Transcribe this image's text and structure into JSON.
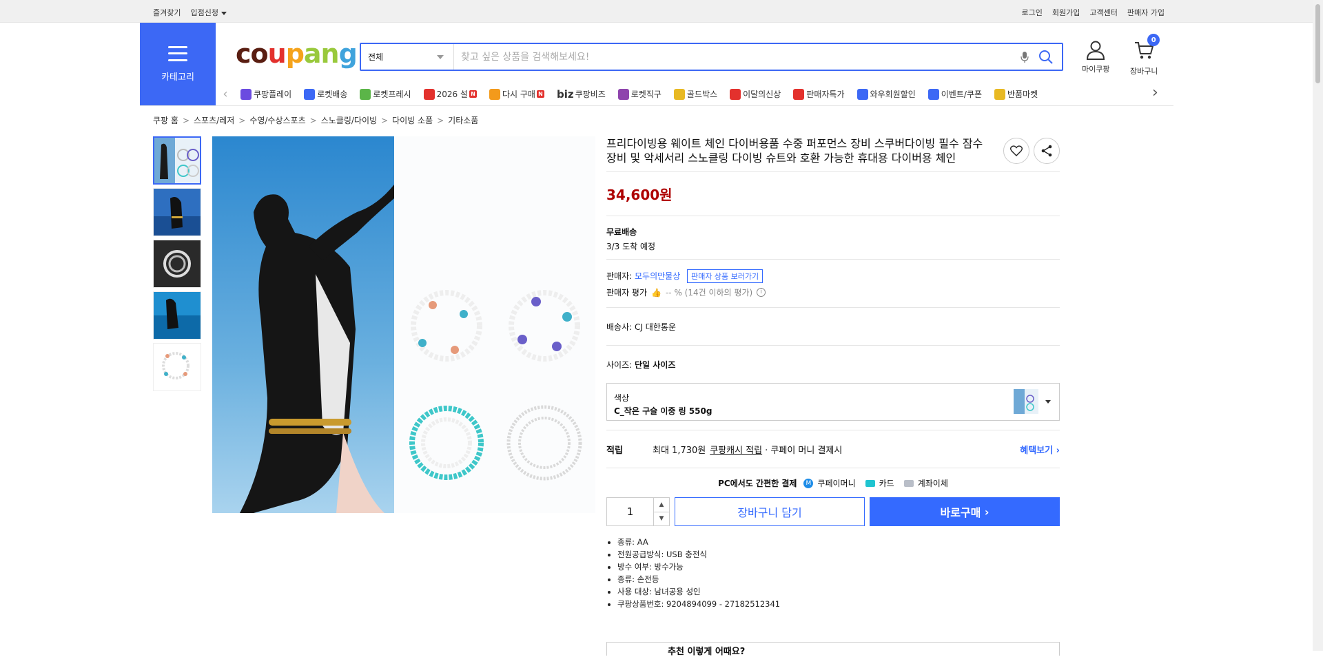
{
  "topbar": {
    "left": [
      "즐겨찾기",
      "입점신청"
    ],
    "right": [
      "로그인",
      "회원가입",
      "고객센터",
      "판매자 가입"
    ]
  },
  "header": {
    "category_label": "카테고리",
    "logo_parts": [
      "co",
      "u",
      "p",
      "an",
      "g"
    ],
    "search_select": "전체",
    "search_placeholder": "찾고 싶은 상품을 검색해보세요!",
    "mypage_label": "마이쿠팡",
    "cart_label": "장바구니",
    "cart_count": "0"
  },
  "nav": [
    {
      "label": "쿠팡플레이",
      "icon": "coupang-play-icon",
      "color": "#6b4be0",
      "badge": ""
    },
    {
      "label": "로켓배송",
      "icon": "rocket-delivery-icon",
      "color": "#3c68f5",
      "badge": ""
    },
    {
      "label": "로켓프레시",
      "icon": "rocket-fresh-icon",
      "color": "#5bb548",
      "badge": ""
    },
    {
      "label": "2026 설",
      "icon": "seollal-icon",
      "color": "#e3312d",
      "badge": "N"
    },
    {
      "label": "다시 구매",
      "icon": "rebuy-icon",
      "color": "#f39a1b",
      "badge": "N"
    },
    {
      "label": "쿠팡비즈",
      "icon": "biz-icon",
      "color": "#333333",
      "badge": "",
      "prefix": "biz"
    },
    {
      "label": "로켓직구",
      "icon": "rocket-global-icon",
      "color": "#8e44ad",
      "badge": ""
    },
    {
      "label": "골드박스",
      "icon": "goldbox-icon",
      "color": "#e8b923",
      "badge": ""
    },
    {
      "label": "이달의신상",
      "icon": "new-arrival-icon",
      "color": "#e3312d",
      "badge": ""
    },
    {
      "label": "판매자특가",
      "icon": "seller-deal-icon",
      "color": "#e3312d",
      "badge": ""
    },
    {
      "label": "와우회원할인",
      "icon": "wow-icon",
      "color": "#3c68f5",
      "badge": ""
    },
    {
      "label": "이벤트/쿠폰",
      "icon": "event-coupon-icon",
      "color": "#3c68f5",
      "badge": ""
    },
    {
      "label": "반품마켓",
      "icon": "return-market-icon",
      "color": "#e8b923",
      "badge": ""
    }
  ],
  "breadcrumb": [
    "쿠팡 홈",
    "스포츠/레저",
    "수영/수상스포츠",
    "스노클링/다이빙",
    "다이빙 소품",
    "기타소품"
  ],
  "product": {
    "title": "프리다이빙용 웨이트 체인 다이버용품 수중 퍼포먼스 장비 스쿠버다이빙 필수 잠수 장비 및 악세서리 스노클링 다이빙 슈트와 호환 가능한 휴대용 다이버용 체인",
    "price": "34,600원",
    "shipping_title": "무료배송",
    "shipping_eta": "3/3 도착 예정",
    "seller_label": "판매자:",
    "seller_name": "모두의만물상",
    "seller_link": "판매자 상품 보러가기",
    "seller_rating_label": "판매자 평가",
    "seller_rating_value": "-- % (14건 이하의 평가)",
    "courier_label": "배송사:",
    "courier_name": "CJ 대한통운",
    "size_label": "사이즈:",
    "size_value": "단일 사이즈",
    "color_label": "색상",
    "color_value": "C_작은 구슬 이중 링 550g",
    "reward_label": "적립",
    "reward_text_1": "최대 1,730원",
    "reward_link": "쿠팡캐시 적립",
    "reward_text_2": "· 쿠페이 머니 결제시",
    "benefit_link": "혜택보기",
    "pay_title": "PC에서도 간편한 결제",
    "pay_methods": [
      "쿠페이머니",
      "카드",
      "계좌이체"
    ],
    "quantity": "1",
    "cart_button": "장바구니 담기",
    "buy_button": "바로구매",
    "attributes": [
      "종류: AA",
      "전원공급방식: USB 충전식",
      "방수 여부: 방수가능",
      "종류: 손전등",
      "사용 대상: 남녀공용 성인",
      "쿠팡상품번호: 9204894099 - 27182512341"
    ],
    "bottom_teaser": "추천 이렇게 어때요?"
  },
  "colors": {
    "accent": "#346aff",
    "category_bg": "#3c68f5",
    "price": "#ae0000"
  }
}
